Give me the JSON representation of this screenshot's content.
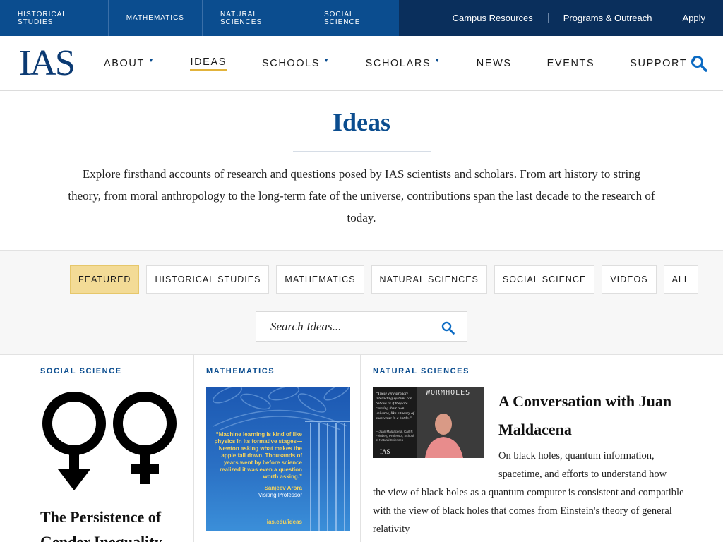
{
  "utility": {
    "schools": [
      "HISTORICAL STUDIES",
      "MATHEMATICS",
      "NATURAL SCIENCES",
      "SOCIAL SCIENCE"
    ],
    "links": [
      "Campus Resources",
      "Programs & Outreach",
      "Apply"
    ]
  },
  "header": {
    "logo": "IAS",
    "nav": [
      "ABOUT",
      "IDEAS",
      "SCHOOLS",
      "SCHOLARS",
      "NEWS",
      "EVENTS",
      "SUPPORT"
    ],
    "active_nav": "IDEAS"
  },
  "page": {
    "title": "Ideas",
    "intro": "Explore firsthand accounts of research and questions posed by IAS scientists and scholars. From art history to string theory, from moral anthropology to the long-term fate of the universe, contributions span the last decade to the research of today."
  },
  "filters": {
    "items": [
      "FEATURED",
      "HISTORICAL STUDIES",
      "MATHEMATICS",
      "NATURAL SCIENCES",
      "SOCIAL SCIENCE",
      "VIDEOS",
      "ALL"
    ],
    "active": "FEATURED"
  },
  "search": {
    "placeholder": "Search Ideas..."
  },
  "cards": {
    "card1": {
      "category": "SOCIAL SCIENCE",
      "title_line1": "The Persistence of",
      "title_line2": "Gender Inequality"
    },
    "card2": {
      "category": "MATHEMATICS",
      "quote": "“Machine learning is kind of like physics in its formative stages—Newton asking what makes the apple fall down. Thousands of years went by before science realized it was even a question worth asking.”",
      "author": "–Sanjeev Arora",
      "author_role": "Visiting Professor",
      "url": "ias.edu/ideas"
    },
    "card3": {
      "category": "NATURAL SCIENCES",
      "title": "A Conversation with Juan Maldacena",
      "desc_line": "On black holes, quantum information, spacetime, and efforts to understand how",
      "desc_rest": "the view of black holes as a quantum computer is consistent and compatible with the view of black holes that comes from Einstein's theory of general relativity",
      "thumb_quote": "“These very strongly interacting systems can behave as if they are creating their own universe, like a theory of a universe in a bottle.”",
      "thumb_sig": "—Juan Maldacena, Carl P. Feinberg Professor, School of Natural Sciences",
      "thumb_logo": "IAS",
      "thumb_board": "WORMHOLES"
    }
  },
  "colors": {
    "navy": "#0a2f5c",
    "blue": "#0b4d8f",
    "gold": "#f3db96",
    "accent_underline": "#e2b33b"
  }
}
